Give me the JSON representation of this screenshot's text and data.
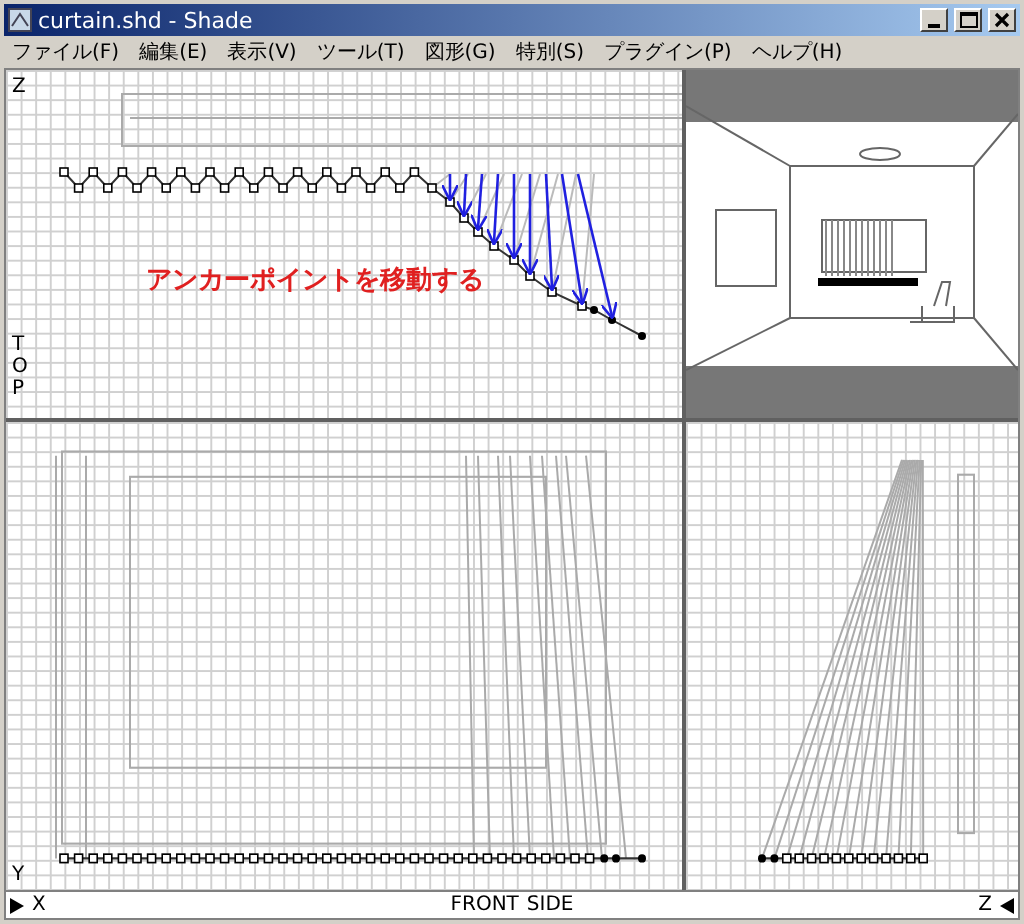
{
  "window": {
    "title": "curtain.shd - Shade"
  },
  "menu": [
    {
      "label": "ファイル(F)"
    },
    {
      "label": "編集(E)"
    },
    {
      "label": "表示(V)"
    },
    {
      "label": "ツール(T)"
    },
    {
      "label": "図形(G)"
    },
    {
      "label": "特別(S)"
    },
    {
      "label": "プラグイン(P)"
    },
    {
      "label": "ヘルプ(H)"
    }
  ],
  "top_view": {
    "axis_label": "Z",
    "view_label": "TOP",
    "annotation": "アンカーポイントを移動する"
  },
  "bottom_bar": {
    "axis_y": "Y",
    "axis_x": "X",
    "front_label": "FRONT",
    "side_label": "SIDE",
    "axis_z": "Z"
  }
}
